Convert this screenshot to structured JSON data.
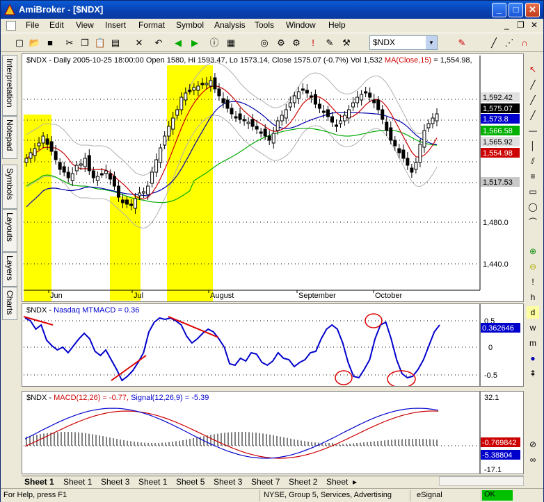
{
  "window": {
    "title": "AmiBroker - [$NDX]",
    "min": "_",
    "max": "□",
    "close": "✕"
  },
  "doc_controls": {
    "min": "_",
    "restore": "❐",
    "close": "✕"
  },
  "menu": [
    "File",
    "Edit",
    "View",
    "Insert",
    "Format",
    "Symbol",
    "Analysis",
    "Tools",
    "Window",
    "Help"
  ],
  "toolbar": {
    "symbol": "$NDX"
  },
  "left_tabs": [
    "Interpretation",
    "Notepad",
    "Symbols",
    "Layouts",
    "Layers",
    "Charts"
  ],
  "price_pane": {
    "header_prefix": "$NDX - Daily 2005-10-25 18:00:00 Open 1580, Hi 1593.47, Lo 1573.14, Close 1575.07 (-0.7%) Vol 1,532 ",
    "header_ma": "MA(Close,15)",
    "header_ma_val": " = 1,554.98,",
    "price_labels": [
      "1,592.42",
      "1,575.07",
      "1,573.8",
      "1,566.58",
      "1,565.92",
      "1,554.98",
      "1,517.53"
    ],
    "price_label_colors": [
      "#e0e0e0",
      "#000000",
      "#0000cc",
      "#00b000",
      "#e0e0e0",
      "#cc0000",
      "#c8c8c8"
    ],
    "axis_ticks": [
      "1,480.0",
      "1,440.0"
    ],
    "x_labels": [
      "Jun",
      "Jul",
      "August",
      "September",
      "October"
    ]
  },
  "macd_pane": {
    "header_sym": "$NDX - ",
    "header_name": "Nasdaq MTMACD = 0.36",
    "axis_ticks": [
      "0.5",
      "0",
      "-0.5"
    ],
    "value_label": "0.362646"
  },
  "macd2_pane": {
    "header_sym": "$NDX - ",
    "header_macd": "MACD(12,26) = -0.77, ",
    "header_signal": "Signal(12,26,9) = -5.39",
    "axis_ticks": [
      "32.1",
      "-17.1"
    ],
    "value_labels": [
      "-0.769842",
      "-5.38804"
    ]
  },
  "sheets": [
    "Sheet 1",
    "Sheet 1",
    "Sheet 3",
    "Sheet 1",
    "Sheet 5",
    "Sheet 3",
    "Sheet 7",
    "Sheet 2",
    "Sheet"
  ],
  "sheet_nav": "▸",
  "status": {
    "help": "For Help, press F1",
    "info": "NYSE, Group 5, Services, Advertising",
    "feed": "eSignal",
    "state": "OK"
  },
  "colors": {
    "highlight": "#ffff00",
    "ma15": "#cc0000",
    "ma_blue": "#0000aa",
    "ma_green": "#00aa00",
    "mtmacd": "#0000cc",
    "annotation": "#dd0000"
  }
}
